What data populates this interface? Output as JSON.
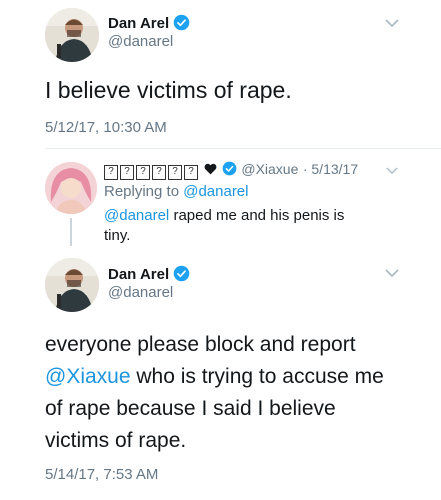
{
  "tweet1": {
    "name": "Dan Arel",
    "handle": "@danarel",
    "text": "I believe victims of rape.",
    "timestamp": "5/12/17, 10:30 AM"
  },
  "reply": {
    "name_glyphs": "??????",
    "handle": "@Xiaxue",
    "date": "· 5/13/17",
    "replying_to_label": "Replying to",
    "replying_to_handle": "@danarel",
    "mention": "@danarel",
    "text_line1": " raped me and his penis is",
    "text_line2": "tiny."
  },
  "tweet2": {
    "name": "Dan Arel",
    "handle": "@danarel",
    "line1": "everyone please block and report",
    "mention": "@Xiaxue",
    "line2_rest": " who is trying to accuse me",
    "line3": "of rape because I said I believe",
    "line4": "victims of rape.",
    "timestamp": "5/14/17, 7:53 AM"
  },
  "colors": {
    "link": "#1b95e0",
    "verified": "#1da1f2",
    "secondary": "#657786",
    "heart": "#14171a"
  },
  "icons": [
    "verified-badge-icon",
    "chevron-down-icon",
    "heart-icon"
  ]
}
